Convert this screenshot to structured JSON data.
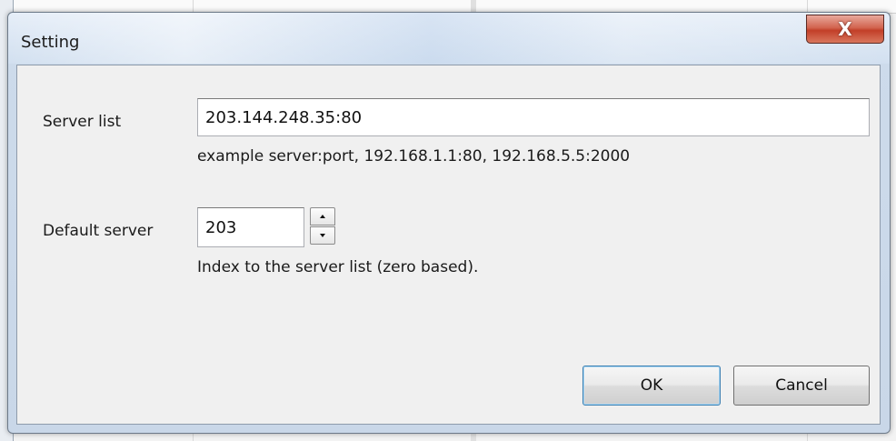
{
  "dialog": {
    "title": "Setting",
    "close_label": "X"
  },
  "server_list": {
    "label": "Server list",
    "value": "203.144.248.35:80",
    "hint": "example server:port, 192.168.1.1:80, 192.168.5.5:2000"
  },
  "default_server": {
    "label": "Default server",
    "value": "203",
    "hint": "Index to the server list (zero based)."
  },
  "buttons": {
    "ok_label": "OK",
    "cancel_label": "Cancel"
  },
  "icons": {
    "close": "close-icon",
    "spin_up": "arrow-up-icon",
    "spin_down": "arrow-down-icon"
  }
}
